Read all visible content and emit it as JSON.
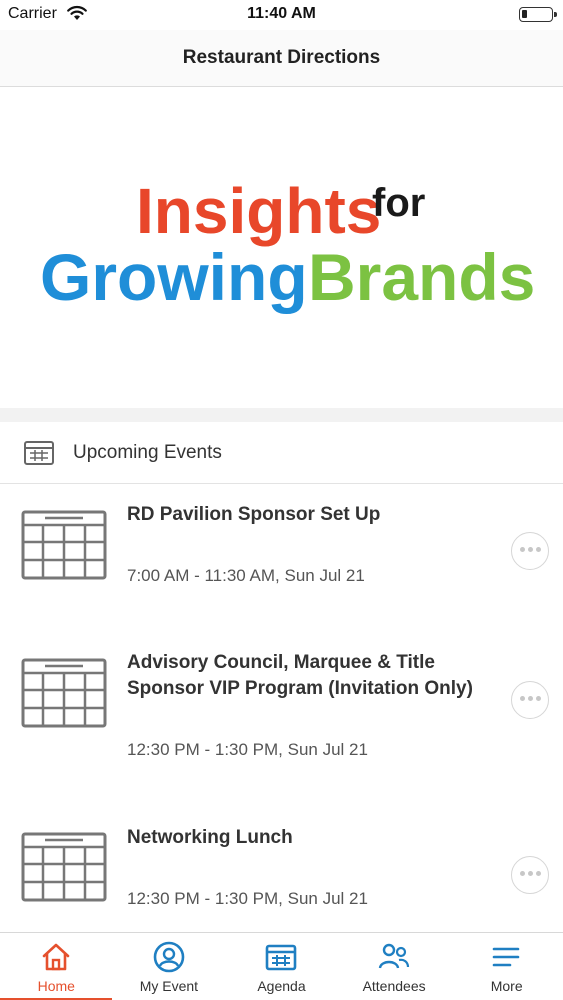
{
  "status_bar": {
    "carrier": "Carrier",
    "time": "11:40 AM",
    "battery_level": 0.2
  },
  "nav": {
    "title": "Restaurant Directions"
  },
  "banner": {
    "logo_text": {
      "line1": "Insights",
      "line1_suffix": "for",
      "line2a": "Growing",
      "line2b": "Brands"
    },
    "colors": {
      "insights": "#e8472a",
      "for": "#1a1a1a",
      "growing": "#1f8ed8",
      "brands": "#7cc242"
    }
  },
  "upcoming": {
    "title": "Upcoming Events",
    "events": [
      {
        "title": "RD Pavilion Sponsor Set Up",
        "time": "7:00 AM - 11:30 AM, Sun Jul 21"
      },
      {
        "title": "Advisory Council, Marquee & Title Sponsor VIP Program (Invitation Only)",
        "time": "12:30 PM - 1:30 PM, Sun Jul 21"
      },
      {
        "title": "Networking Lunch",
        "time": "12:30 PM - 1:30 PM, Sun Jul 21"
      }
    ]
  },
  "tabs": [
    {
      "label": "Home",
      "icon": "home-icon",
      "active": true
    },
    {
      "label": "My Event",
      "icon": "user-circle-icon",
      "active": false
    },
    {
      "label": "Agenda",
      "icon": "calendar-icon",
      "active": false
    },
    {
      "label": "Attendees",
      "icon": "people-icon",
      "active": false
    },
    {
      "label": "More",
      "icon": "menu-icon",
      "active": false
    }
  ],
  "colors": {
    "accent": "#e5502d",
    "tab_icon": "#1f7fc2"
  }
}
